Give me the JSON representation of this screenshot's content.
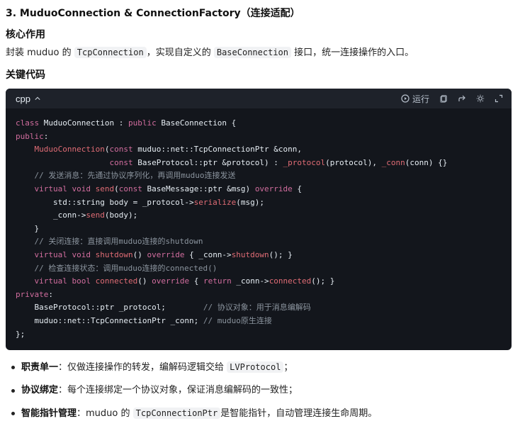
{
  "section": {
    "title": "3. MuduoConnection & ConnectionFactory（连接适配）",
    "core_heading": "核心作用",
    "intro": {
      "prefix": "封装 muduo 的",
      "code1": "TcpConnection",
      "middle": "，实现自定义的",
      "code2": "BaseConnection",
      "suffix": "接口，统一连接操作的入口。"
    },
    "key_heading": "关键代码"
  },
  "code_block": {
    "language": "cpp",
    "run_label": "运行",
    "icons": [
      "play-icon",
      "copy-icon",
      "share-icon",
      "theme-icon",
      "expand-icon"
    ],
    "lines": [
      "class MuduoConnection : public BaseConnection {",
      "public:",
      "    MuduoConnection(const muduo::net::TcpConnectionPtr &conn,",
      "                    const BaseProtocol::ptr &protocol) : _protocol(protocol), _conn(conn) {}",
      "    // 发送消息：先通过协议序列化，再调用muduo连接发送",
      "    virtual void send(const BaseMessage::ptr &msg) override {",
      "        std::string body = _protocol->serialize(msg);",
      "        _conn->send(body);",
      "    }",
      "    // 关闭连接：直接调用muduo连接的shutdown",
      "    virtual void shutdown() override { _conn->shutdown(); }",
      "    // 检查连接状态：调用muduo连接的connected()",
      "    virtual bool connected() override { return _conn->connected(); }",
      "private:",
      "    BaseProtocol::ptr _protocol;        // 协议对象：用于消息编解码",
      "    muduo::net::TcpConnectionPtr _conn; // muduo原生连接",
      "};"
    ]
  },
  "bullets": [
    {
      "title": "职责单一",
      "text": "：仅做连接操作的转发，编解码逻辑交给",
      "code": "LVProtocol",
      "tail": "；"
    },
    {
      "title": "协议绑定",
      "text": "：每个连接绑定一个协议对象，保证消息编解码的一致性；",
      "code": "",
      "tail": ""
    },
    {
      "title": "智能指针管理",
      "text": "：muduo 的",
      "code": "TcpConnectionPtr",
      "tail": "是智能指针，自动管理连接生命周期。"
    }
  ]
}
